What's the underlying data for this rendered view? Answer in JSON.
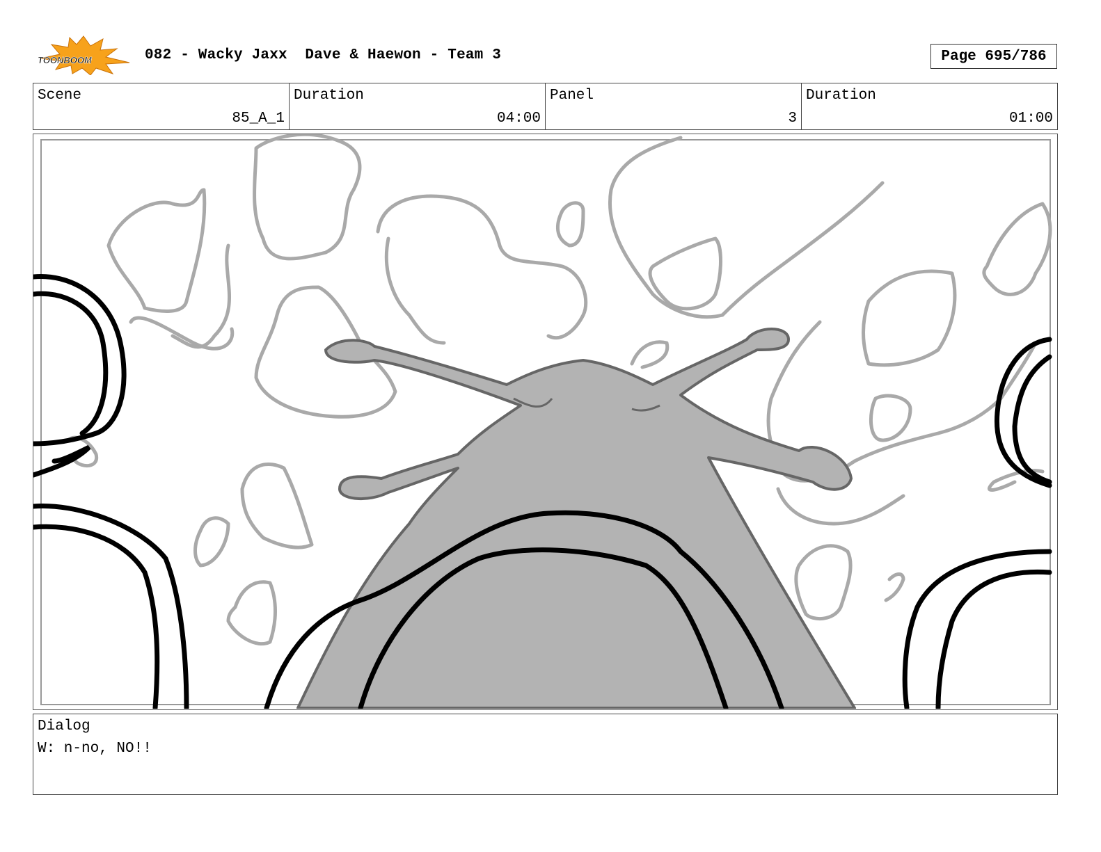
{
  "header": {
    "logo_text": "TOONBOOM",
    "title": "082 - Wacky Jaxx  Dave & Haewon - Team 3",
    "page": "Page 695/786"
  },
  "info": {
    "scene_label": "Scene",
    "scene_value": "85_A_1",
    "scene_duration_label": "Duration",
    "scene_duration_value": "04:00",
    "panel_label": "Panel",
    "panel_value": "3",
    "panel_duration_label": "Duration",
    "panel_duration_value": "01:00"
  },
  "dialog": {
    "label": "Dialog",
    "line": "W: n-no, NO!!"
  },
  "colors": {
    "burst": "#f7a21b",
    "sketch_gray": "#a9a9a9",
    "fill_gray": "#b3b3b3",
    "ink": "#000000"
  }
}
